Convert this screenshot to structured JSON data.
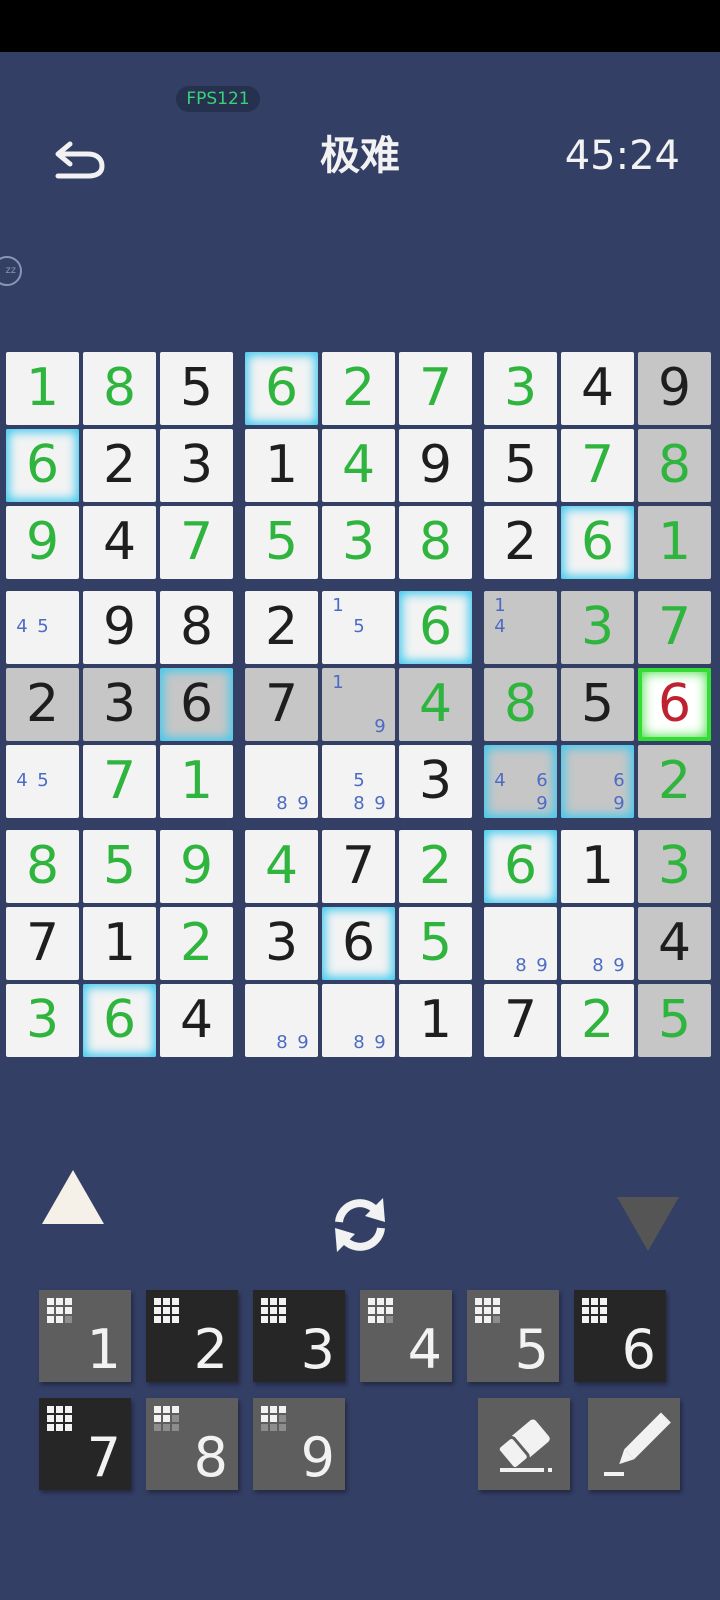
{
  "header": {
    "fps_label": "FPS121",
    "title": "极难",
    "timer": "45:24"
  },
  "board": {
    "rows": [
      [
        {
          "v": "1",
          "t": "user",
          "bg": "w"
        },
        {
          "v": "8",
          "t": "user",
          "bg": "w"
        },
        {
          "v": "5",
          "t": "given",
          "bg": "w"
        },
        {
          "v": "6",
          "t": "user",
          "bg": "w",
          "hl": true
        },
        {
          "v": "2",
          "t": "user",
          "bg": "w"
        },
        {
          "v": "7",
          "t": "user",
          "bg": "w"
        },
        {
          "v": "3",
          "t": "user",
          "bg": "w"
        },
        {
          "v": "4",
          "t": "given",
          "bg": "w"
        },
        {
          "v": "9",
          "t": "given",
          "bg": "g"
        }
      ],
      [
        {
          "v": "6",
          "t": "user",
          "bg": "w",
          "hl": true
        },
        {
          "v": "2",
          "t": "given",
          "bg": "w"
        },
        {
          "v": "3",
          "t": "given",
          "bg": "w"
        },
        {
          "v": "1",
          "t": "given",
          "bg": "w"
        },
        {
          "v": "4",
          "t": "user",
          "bg": "w"
        },
        {
          "v": "9",
          "t": "given",
          "bg": "w"
        },
        {
          "v": "5",
          "t": "given",
          "bg": "w"
        },
        {
          "v": "7",
          "t": "user",
          "bg": "w"
        },
        {
          "v": "8",
          "t": "user",
          "bg": "g"
        }
      ],
      [
        {
          "v": "9",
          "t": "user",
          "bg": "w"
        },
        {
          "v": "4",
          "t": "given",
          "bg": "w"
        },
        {
          "v": "7",
          "t": "user",
          "bg": "w"
        },
        {
          "v": "5",
          "t": "user",
          "bg": "w"
        },
        {
          "v": "3",
          "t": "user",
          "bg": "w"
        },
        {
          "v": "8",
          "t": "user",
          "bg": "w"
        },
        {
          "v": "2",
          "t": "given",
          "bg": "w"
        },
        {
          "v": "6",
          "t": "user",
          "bg": "w",
          "hl": true
        },
        {
          "v": "1",
          "t": "user",
          "bg": "g"
        }
      ],
      [
        {
          "v": "",
          "bg": "w",
          "notes": [
            "4",
            "5"
          ]
        },
        {
          "v": "9",
          "t": "given",
          "bg": "w"
        },
        {
          "v": "8",
          "t": "given",
          "bg": "w"
        },
        {
          "v": "2",
          "t": "given",
          "bg": "w"
        },
        {
          "v": "",
          "bg": "w",
          "notes": [
            "1",
            "5"
          ]
        },
        {
          "v": "6",
          "t": "user",
          "bg": "w",
          "hl": true
        },
        {
          "v": "",
          "bg": "g",
          "notes": [
            "1",
            "4"
          ]
        },
        {
          "v": "3",
          "t": "user",
          "bg": "g"
        },
        {
          "v": "7",
          "t": "user",
          "bg": "g"
        }
      ],
      [
        {
          "v": "2",
          "t": "given",
          "bg": "g"
        },
        {
          "v": "3",
          "t": "given",
          "bg": "g"
        },
        {
          "v": "6",
          "t": "given",
          "bg": "g",
          "hl": true
        },
        {
          "v": "7",
          "t": "given",
          "bg": "g"
        },
        {
          "v": "",
          "bg": "g",
          "notes": [
            "1",
            "9"
          ]
        },
        {
          "v": "4",
          "t": "user",
          "bg": "g"
        },
        {
          "v": "8",
          "t": "user",
          "bg": "g"
        },
        {
          "v": "5",
          "t": "given",
          "bg": "g"
        },
        {
          "v": "6",
          "t": "err",
          "bg": "sel"
        }
      ],
      [
        {
          "v": "",
          "bg": "w",
          "notes": [
            "4",
            "5"
          ]
        },
        {
          "v": "7",
          "t": "user",
          "bg": "w"
        },
        {
          "v": "1",
          "t": "user",
          "bg": "w"
        },
        {
          "v": "",
          "bg": "w",
          "notes": [
            "8",
            "9"
          ]
        },
        {
          "v": "",
          "bg": "w",
          "notes": [
            "5",
            "8",
            "9"
          ]
        },
        {
          "v": "3",
          "t": "given",
          "bg": "w"
        },
        {
          "v": "",
          "bg": "g",
          "hl": true,
          "notes": [
            "4",
            "6",
            "9"
          ]
        },
        {
          "v": "",
          "bg": "g",
          "hl": true,
          "notes": [
            "6",
            "9"
          ]
        },
        {
          "v": "2",
          "t": "user",
          "bg": "g"
        }
      ],
      [
        {
          "v": "8",
          "t": "user",
          "bg": "w"
        },
        {
          "v": "5",
          "t": "user",
          "bg": "w"
        },
        {
          "v": "9",
          "t": "user",
          "bg": "w"
        },
        {
          "v": "4",
          "t": "user",
          "bg": "w"
        },
        {
          "v": "7",
          "t": "given",
          "bg": "w"
        },
        {
          "v": "2",
          "t": "user",
          "bg": "w"
        },
        {
          "v": "6",
          "t": "user",
          "bg": "w",
          "hl": true
        },
        {
          "v": "1",
          "t": "given",
          "bg": "w"
        },
        {
          "v": "3",
          "t": "user",
          "bg": "g"
        }
      ],
      [
        {
          "v": "7",
          "t": "given",
          "bg": "w"
        },
        {
          "v": "1",
          "t": "given",
          "bg": "w"
        },
        {
          "v": "2",
          "t": "user",
          "bg": "w"
        },
        {
          "v": "3",
          "t": "given",
          "bg": "w"
        },
        {
          "v": "6",
          "t": "given",
          "bg": "w",
          "hl": true
        },
        {
          "v": "5",
          "t": "user",
          "bg": "w"
        },
        {
          "v": "",
          "bg": "w",
          "notes": [
            "8",
            "9"
          ]
        },
        {
          "v": "",
          "bg": "w",
          "notes": [
            "8",
            "9"
          ]
        },
        {
          "v": "4",
          "t": "given",
          "bg": "g"
        }
      ],
      [
        {
          "v": "3",
          "t": "user",
          "bg": "w"
        },
        {
          "v": "6",
          "t": "user",
          "bg": "w",
          "hl": true
        },
        {
          "v": "4",
          "t": "given",
          "bg": "w"
        },
        {
          "v": "",
          "bg": "w",
          "notes": [
            "8",
            "9"
          ]
        },
        {
          "v": "",
          "bg": "w",
          "notes": [
            "8",
            "9"
          ]
        },
        {
          "v": "1",
          "t": "given",
          "bg": "w"
        },
        {
          "v": "7",
          "t": "given",
          "bg": "w"
        },
        {
          "v": "2",
          "t": "user",
          "bg": "w"
        },
        {
          "v": "5",
          "t": "user",
          "bg": "g"
        }
      ]
    ]
  },
  "colors": {
    "background": "#343f66",
    "user_digit": "#2fb43d",
    "given_digit": "#1e1e1e",
    "error_digit": "#c0212e",
    "note": "#4c6cc4",
    "highlight_glow": "#3ec9ef",
    "selected_border": "#33dd33"
  },
  "keypad": [
    {
      "label": "1",
      "style": "lt",
      "remaining": 1
    },
    {
      "label": "2",
      "style": "dk",
      "remaining": 0
    },
    {
      "label": "3",
      "style": "dk",
      "remaining": 0
    },
    {
      "label": "4",
      "style": "lt",
      "remaining": 1
    },
    {
      "label": "5",
      "style": "lt",
      "remaining": 1
    },
    {
      "label": "6",
      "style": "dk",
      "remaining": 0
    },
    {
      "label": "7",
      "style": "dk",
      "remaining": 0
    },
    {
      "label": "8",
      "style": "lt",
      "remaining": 4
    },
    {
      "label": "9",
      "style": "lt",
      "remaining": 4
    }
  ],
  "controls": {
    "up_icon": "triangle-up-icon",
    "swap_icon": "refresh-icon",
    "down_icon": "triangle-down-icon",
    "erase_icon": "eraser-icon",
    "pencil_icon": "pencil-icon",
    "back_icon": "undo-arrow-icon"
  }
}
